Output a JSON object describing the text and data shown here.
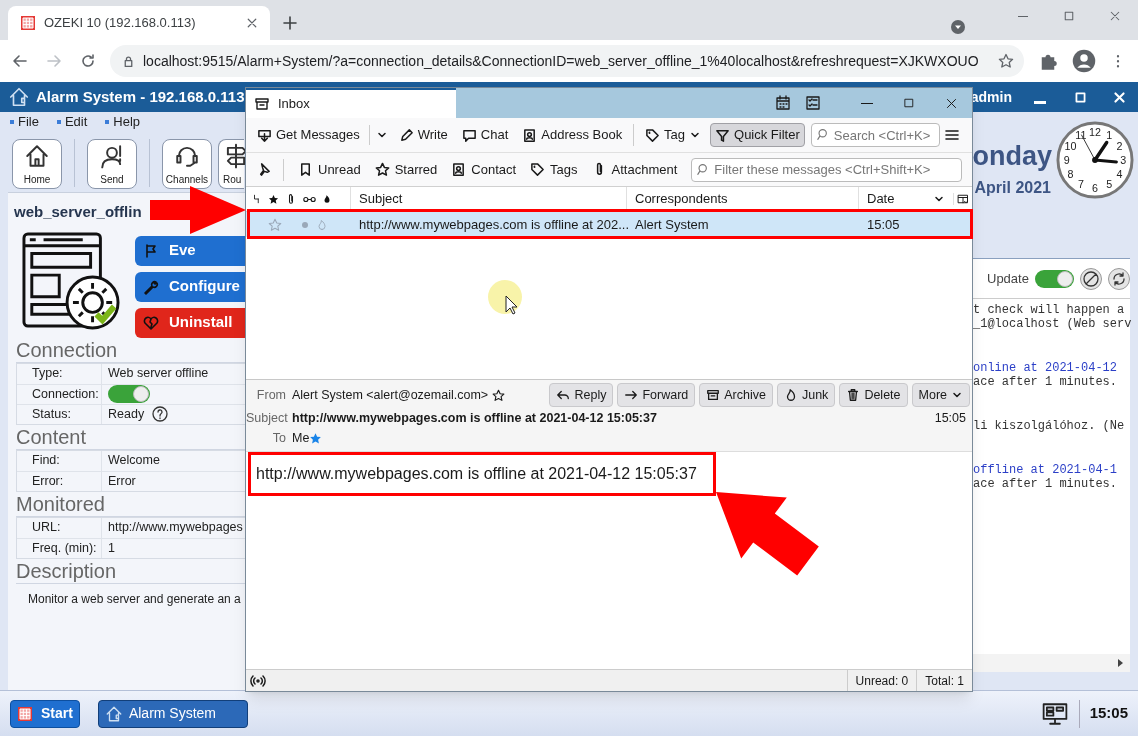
{
  "browser": {
    "tab_title": "OZEKI 10 (192.168.0.113)",
    "url": "localhost:9515/Alarm+System/?a=connection_details&ConnectionID=web_server_offline_1%40localhost&refreshrequest=XJKWXOUO"
  },
  "app": {
    "title": "Alarm System - 192.168.0.113",
    "user": "admin",
    "menu": [
      "File",
      "Edit",
      "Help"
    ],
    "toolbar": [
      {
        "label": "Home",
        "kind": "home"
      },
      {
        "label": "Send",
        "kind": "send"
      },
      {
        "label": "Channels",
        "kind": "channels"
      },
      {
        "label": "Rou",
        "kind": "routes"
      }
    ],
    "day": "onday",
    "date": "April 2021",
    "clock_numerals": [
      "11",
      "12",
      "1",
      "10",
      "2",
      "9",
      "3",
      "8",
      "4",
      "7",
      "6",
      "5"
    ],
    "connection_name": "web_server_offlin",
    "actions": [
      {
        "label": "Eve",
        "kind": "events"
      },
      {
        "label": "Configure",
        "kind": "configure"
      },
      {
        "label": "Uninstall",
        "kind": "uninstall"
      }
    ],
    "sections": [
      {
        "title": "Connection",
        "rows": [
          {
            "label": "Type:",
            "kind": "text",
            "value": "Web server offline"
          },
          {
            "label": "Connection:",
            "kind": "toggle",
            "on": true
          },
          {
            "label": "Status:",
            "kind": "help",
            "value": "Ready"
          }
        ]
      },
      {
        "title": "Content",
        "rows": [
          {
            "label": "Find:",
            "kind": "text",
            "value": "Welcome"
          },
          {
            "label": "Error:",
            "kind": "text",
            "value": "Error"
          }
        ]
      },
      {
        "title": "Monitored",
        "rows": [
          {
            "label": "URL:",
            "kind": "text",
            "value": "http://www.mywebpages"
          },
          {
            "label": "Freq. (min):",
            "kind": "text",
            "value": "1"
          }
        ]
      },
      {
        "title": "Description"
      }
    ],
    "description": "Monitor a web server and generate an a",
    "update": {
      "label": "Update",
      "on": true
    },
    "log": [
      {
        "lines": [
          {
            "text": "t check will happen a",
            "kind": "plain"
          },
          {
            "text": "_1@localhost (Web serv",
            "kind": "plain"
          }
        ]
      },
      {
        "lines": [
          {
            "text": "online at 2021-04-12",
            "kind": "link"
          },
          {
            "text": "ace after 1 minutes.",
            "kind": "plain"
          }
        ]
      },
      {
        "lines": [
          {
            "text": "li kiszolgálóhoz. (Ne",
            "kind": "plain"
          }
        ]
      },
      {
        "lines": [
          {
            "text": "offline at 2021-04-1",
            "kind": "link"
          },
          {
            "text": "ace after 1 minutes.",
            "kind": "plain"
          }
        ]
      }
    ]
  },
  "taskbar": {
    "start": "Start",
    "app": "Alarm System",
    "clock": "15:05"
  },
  "mail": {
    "tab": "Inbox",
    "toolbar": [
      {
        "label": "Get Messages",
        "kind": "get",
        "selected": false
      },
      {
        "label": "Write",
        "kind": "write",
        "selected": false
      },
      {
        "label": "Chat",
        "kind": "chat",
        "selected": false
      },
      {
        "label": "Address Book",
        "kind": "book",
        "selected": false
      },
      {
        "label": "Tag",
        "kind": "tag",
        "selected": false
      },
      {
        "label": "Quick Filter",
        "kind": "filter",
        "selected": true
      }
    ],
    "search": {
      "placeholder": "Search <Ctrl+K>"
    },
    "filters": [
      {
        "label": "Unread",
        "kind": "unread"
      },
      {
        "label": "Starred",
        "kind": "star"
      },
      {
        "label": "Contact",
        "kind": "contact"
      },
      {
        "label": "Tags",
        "kind": "tag"
      },
      {
        "label": "Attachment",
        "kind": "attach"
      }
    ],
    "filter_field": {
      "placeholder": "Filter these messages <Ctrl+Shift+K>"
    },
    "columns": [
      "Subject",
      "Correspondents",
      "Date"
    ],
    "messages": [
      {
        "subject": "http://www.mywebpages.com is offline at 202...",
        "correspondent": "Alert System",
        "date": "15:05",
        "selected": true
      }
    ],
    "header": {
      "from_label": "From",
      "from": "Alert System <alert@ozemail.com>",
      "subject_label": "Subject",
      "subject": "http://www.mywebpages.com is offline at 2021-04-12 15:05:37",
      "time": "15:05",
      "to_label": "To",
      "to": "Me"
    },
    "actions": [
      {
        "label": "Reply",
        "kind": "reply"
      },
      {
        "label": "Forward",
        "kind": "forward"
      },
      {
        "label": "Archive",
        "kind": "archive"
      },
      {
        "label": "Junk",
        "kind": "junk"
      },
      {
        "label": "Delete",
        "kind": "delete"
      },
      {
        "label": "More",
        "kind": "more"
      }
    ],
    "body": "http://www.mywebpages.com is offline at 2021-04-12 15:05:37",
    "status": {
      "unread": "Unread: 0",
      "total": "Total: 1"
    }
  }
}
